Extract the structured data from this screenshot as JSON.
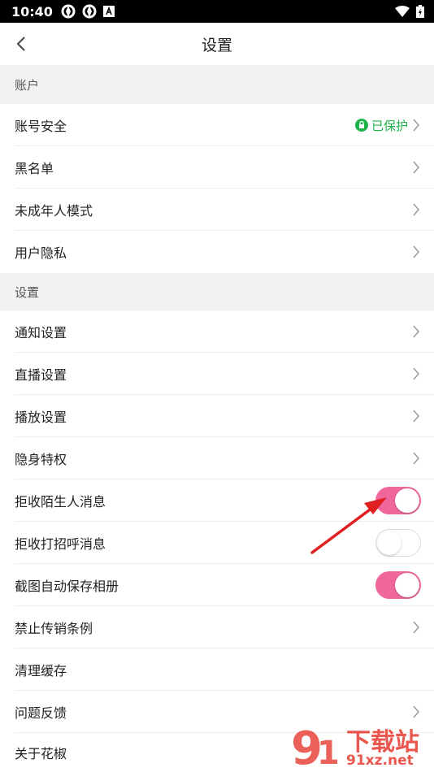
{
  "status_bar": {
    "time": "10:40"
  },
  "nav": {
    "title": "设置"
  },
  "sections": {
    "account": {
      "header": "账户",
      "items": [
        {
          "label": "账号安全",
          "badge": "已保护"
        },
        {
          "label": "黑名单"
        },
        {
          "label": "未成年人模式"
        },
        {
          "label": "用户隐私"
        }
      ]
    },
    "settings": {
      "header": "设置",
      "items": [
        {
          "label": "通知设置"
        },
        {
          "label": "直播设置"
        },
        {
          "label": "播放设置"
        },
        {
          "label": "隐身特权"
        },
        {
          "label": "拒收陌生人消息",
          "toggle": true
        },
        {
          "label": "拒收打招呼消息",
          "toggle": false
        },
        {
          "label": "截图自动保存相册",
          "toggle": true
        },
        {
          "label": "禁止传销条例"
        },
        {
          "label": "清理缓存"
        },
        {
          "label": "问题反馈"
        },
        {
          "label": "关于花椒"
        }
      ]
    }
  },
  "colors": {
    "toggle_on": "#f0679b",
    "badge_green": "#1fb34a",
    "section_bg": "#f2f2f2",
    "arrow": "#e02020"
  },
  "watermark": {
    "text": "下载站",
    "url_text": "91xz.net"
  }
}
